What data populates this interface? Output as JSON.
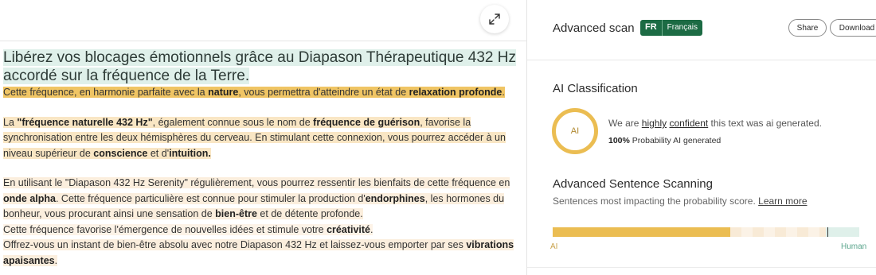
{
  "document": {
    "title": "Libérez vos blocages émotionnels grâce au Diapason Thérapeutique 432 Hz accordé sur la fréquence de la Terre.",
    "p1": {
      "a": "Cette fréquence, en harmonie parfaite avec la ",
      "b": "nature",
      "c": ", vous permettra d'atteindre un état de ",
      "d": "relaxation profonde",
      "e": "."
    },
    "p2": {
      "a": "La ",
      "b": "\"fréquence naturelle 432 Hz\"",
      "c": ", également connue sous le nom de ",
      "d": "fréquence de guérison",
      "e": ", favorise la synchronisation entre les deux hémisphères du cerveau. En stimulant cette connexion, vous pourrez accéder à un niveau supérieur de ",
      "f": "conscience",
      "g": " et d'",
      "h": "intuition."
    },
    "p3": {
      "a": "En utilisant le \"Diapason 432 Hz Serenity\" régulièrement, vous pourrez ressentir les bienfaits de cette fréquence en ",
      "b": "onde alpha",
      "c": ". Cette fréquence particulière est connue pour stimuler la production d'",
      "d": "endorphines",
      "e": ", les hormones du bonheur, vous procurant ainsi une sensation de ",
      "f": "bien-être",
      "g": " et de détente profonde."
    },
    "p4": {
      "a": "Cette fréquence favorise l'émergence de nouvelles idées et stimule votre ",
      "b": "créativité",
      "c": "."
    },
    "p5": {
      "a": "Offrez-vous un instant de bien-être absolu avec notre Diapason 432 Hz et laissez-vous emporter par ses ",
      "b": "vibrations apaisantes",
      "c": "."
    }
  },
  "panel": {
    "title": "Advanced scan",
    "lang_code": "FR",
    "lang_name": "Français",
    "share_label": "Share",
    "download_label": "Download",
    "classification_title": "AI Classification",
    "ring_label": "AI",
    "conf_prefix": "We are ",
    "conf_level": "highly",
    "conf_word": "confident",
    "conf_suffix": " this text was ai generated.",
    "prob_value": "100%",
    "prob_text": " Probability AI generated",
    "scanning_title": "Advanced Sentence Scanning",
    "scanning_sub": "Sentences most impacting the probability score. ",
    "learn_more": "Learn more",
    "bar_left_label": "AI",
    "bar_right_label": "Human",
    "bar_ai_fraction": 0.58,
    "bar_mixed_fraction": 0.31,
    "bar_human_fraction": 0.11,
    "bar_marker_fraction": 0.895
  },
  "colors": {
    "ai": "#ebbd52",
    "human": "#dff0ea",
    "lang_badge": "#1c6b44"
  }
}
